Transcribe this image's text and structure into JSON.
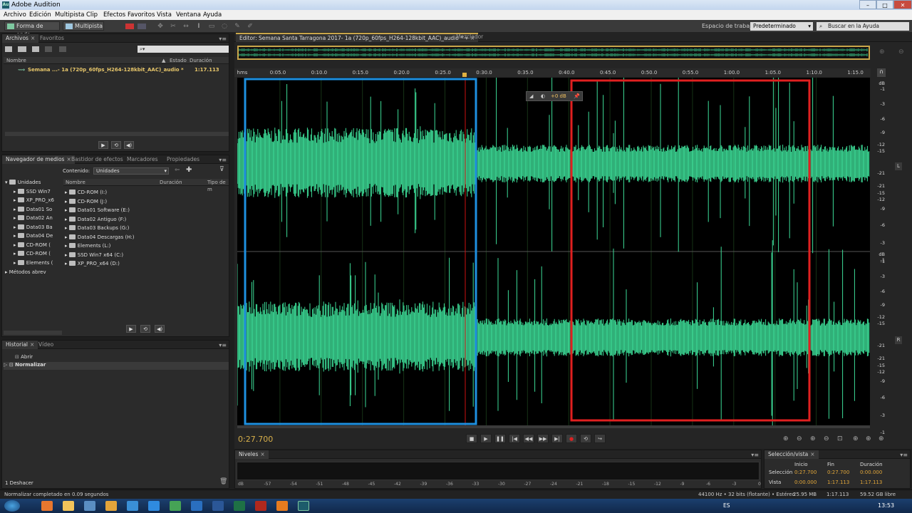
{
  "window": {
    "title": "Adobe Audition",
    "app_icon": "Au",
    "min": "–",
    "max": "□",
    "close": "✕"
  },
  "menu": [
    "Archivo",
    "Edición",
    "Multipista",
    "Clip",
    "Efectos",
    "Favoritos",
    "Vista",
    "Ventana",
    "Ayuda"
  ],
  "toolbar": {
    "waveform_label": "Forma de onda",
    "multitrack_label": "Multipista",
    "workspace_label": "Espacio de trabajo:",
    "workspace_value": "Predeterminado",
    "help_placeholder": "Buscar en la Ayuda"
  },
  "files_panel": {
    "tabs": [
      "Archivos",
      "Favoritos"
    ],
    "columns": [
      "Nombre",
      "Estado",
      "Duración"
    ],
    "items": [
      {
        "name": "Semana ...- 1a (720p_60fps_H264-128kbit_AAC)_audio *",
        "duration": "1:17.113"
      }
    ]
  },
  "media_panel": {
    "tabs": [
      "Navegador de medios",
      "Bastidor de efectos",
      "Marcadores",
      "Propiedades"
    ],
    "content_label": "Contenido:",
    "content_value": "Unidades",
    "tree_root": "Unidades",
    "tree": [
      "SSD Win7",
      "XP_PRO_x6",
      "Data01 So",
      "Data02 An",
      "Data03 Ba",
      "Data04 De",
      "CD-ROM (",
      "CD-ROM (",
      "Elements ("
    ],
    "tree_other": "Métodos abrev",
    "columns": [
      "Nombre",
      "Duración",
      "Tipo de m"
    ],
    "items": [
      "CD-ROM (I:)",
      "CD-ROM (J:)",
      "Data01 Software (E:)",
      "Data02 Antiguo (F:)",
      "Data03 Backups (G:)",
      "Data04 Descargas (H:)",
      "Elements (L:)",
      "SSD Win7 x64 (C:)",
      "XP_PRO_x64 (D:)"
    ]
  },
  "history_panel": {
    "tabs": [
      "Historial",
      "Vídeo"
    ],
    "items": [
      "Abrir",
      "Normalizar"
    ],
    "undo_count": "1 Deshacer"
  },
  "editor": {
    "tab_label": "Editor: Semana Santa Tarragona 2017- 1a (720p_60fps_H264-128kbit_AAC)_audio *",
    "mixer_tab": "Mezclador",
    "ruler_unit": "hms",
    "ruler_ticks": [
      "0:05.0",
      "0:10.0",
      "0:15.0",
      "0:20.0",
      "0:25.0",
      "0:30.0",
      "0:35.0",
      "0:40.0",
      "0:45.0",
      "0:50.0",
      "0:55.0",
      "1:00.0",
      "1:05.0",
      "1:10.0",
      "1:15.0"
    ],
    "db_unit": "dB",
    "db_scale": [
      "-1",
      "-3",
      "-6",
      "-9",
      "-12",
      "-15",
      "-21",
      "-21",
      "-15",
      "-12",
      "-9",
      "-6",
      "-3",
      "-1"
    ],
    "channel_left": "L",
    "channel_right": "R",
    "hud_gain": "+0 dB",
    "current_time": "0:27.700",
    "overlay_colors": {
      "blue": "#1e90e0",
      "red": "#e02020",
      "wave": "#3ddc97",
      "playhead": "#cc1111"
    },
    "playhead_fraction": 0.36
  },
  "levels_panel": {
    "tab": "Niveles",
    "scale": [
      "dB",
      "-57",
      "-54",
      "-51",
      "-48",
      "-45",
      "-42",
      "-39",
      "-36",
      "-33",
      "-30",
      "-27",
      "-24",
      "-21",
      "-18",
      "-15",
      "-12",
      "-9",
      "-6",
      "-3",
      "0"
    ]
  },
  "selection_panel": {
    "tab": "Selección/vista",
    "col_start": "Inicio",
    "col_end": "Fin",
    "col_duration": "Duración",
    "row_selection": "Selección",
    "sel_start": "0:27.700",
    "sel_end": "0:27.700",
    "sel_duration": "0:00.000",
    "row_view": "Vista",
    "view_start": "0:00.000",
    "view_end": "1:17.113",
    "view_duration": "1:17.113"
  },
  "status": {
    "message": "Normalizar completado en 0.09 segundos",
    "format": "44100 Hz • 32 bits (flotante) • Estéreo",
    "size": "25.95 MB",
    "duration": "1:17.113",
    "free": "59.52 GB libre"
  },
  "taskbar": {
    "lang": "ES",
    "clock": "13:53"
  }
}
